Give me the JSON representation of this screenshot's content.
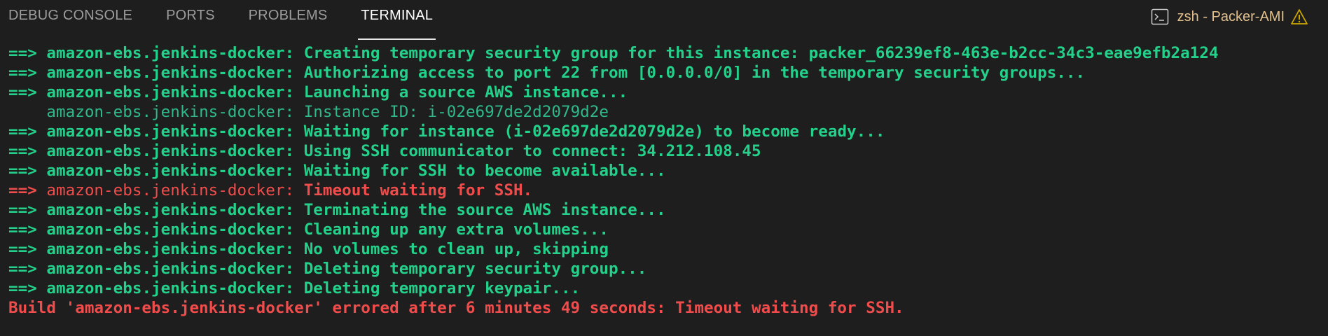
{
  "tabs": [
    {
      "label": "DEBUG CONSOLE",
      "active": false
    },
    {
      "label": "PORTS",
      "active": false
    },
    {
      "label": "PROBLEMS",
      "active": false
    },
    {
      "label": "TERMINAL",
      "active": true
    }
  ],
  "terminal": {
    "name": "zsh - Packer-AMI",
    "icon": "terminal-icon",
    "status_icon": "warning-icon"
  },
  "colors": {
    "background": "#1e1e1e",
    "success": "#23d18b",
    "error": "#f14c4c",
    "terminal_name": "#e2c08d",
    "warning": "#cca700"
  },
  "output": {
    "lines": [
      {
        "arrow": "==> ",
        "source": "amazon-ebs.jenkins-docker:",
        "message": " Creating temporary security group for this instance: packer_66239ef8-463e-b2cc-34c3-eae9efb2a124",
        "level": "info"
      },
      {
        "arrow": "==> ",
        "source": "amazon-ebs.jenkins-docker:",
        "message": " Authorizing access to port 22 from [0.0.0.0/0] in the temporary security groups...",
        "level": "info"
      },
      {
        "arrow": "==> ",
        "source": "amazon-ebs.jenkins-docker:",
        "message": " Launching a source AWS instance...",
        "level": "info"
      },
      {
        "arrow": "    ",
        "source": "amazon-ebs.jenkins-docker:",
        "message": " Instance ID: i-02e697de2d2079d2e",
        "level": "detail"
      },
      {
        "arrow": "==> ",
        "source": "amazon-ebs.jenkins-docker:",
        "message": " Waiting for instance (i-02e697de2d2079d2e) to become ready...",
        "level": "info"
      },
      {
        "arrow": "==> ",
        "source": "amazon-ebs.jenkins-docker:",
        "message": " Using SSH communicator to connect: 34.212.108.45",
        "level": "info"
      },
      {
        "arrow": "==> ",
        "source": "amazon-ebs.jenkins-docker:",
        "message": " Waiting for SSH to become available...",
        "level": "info"
      },
      {
        "arrow": "==> ",
        "source": "amazon-ebs.jenkins-docker:",
        "message": " Timeout waiting for SSH.",
        "level": "error"
      },
      {
        "arrow": "==> ",
        "source": "amazon-ebs.jenkins-docker:",
        "message": " Terminating the source AWS instance...",
        "level": "info"
      },
      {
        "arrow": "==> ",
        "source": "amazon-ebs.jenkins-docker:",
        "message": " Cleaning up any extra volumes...",
        "level": "info"
      },
      {
        "arrow": "==> ",
        "source": "amazon-ebs.jenkins-docker:",
        "message": " No volumes to clean up, skipping",
        "level": "info"
      },
      {
        "arrow": "==> ",
        "source": "amazon-ebs.jenkins-docker:",
        "message": " Deleting temporary security group...",
        "level": "info"
      },
      {
        "arrow": "==> ",
        "source": "amazon-ebs.jenkins-docker:",
        "message": " Deleting temporary keypair...",
        "level": "info"
      }
    ],
    "final": "Build 'amazon-ebs.jenkins-docker' errored after 6 minutes 49 seconds: Timeout waiting for SSH."
  }
}
